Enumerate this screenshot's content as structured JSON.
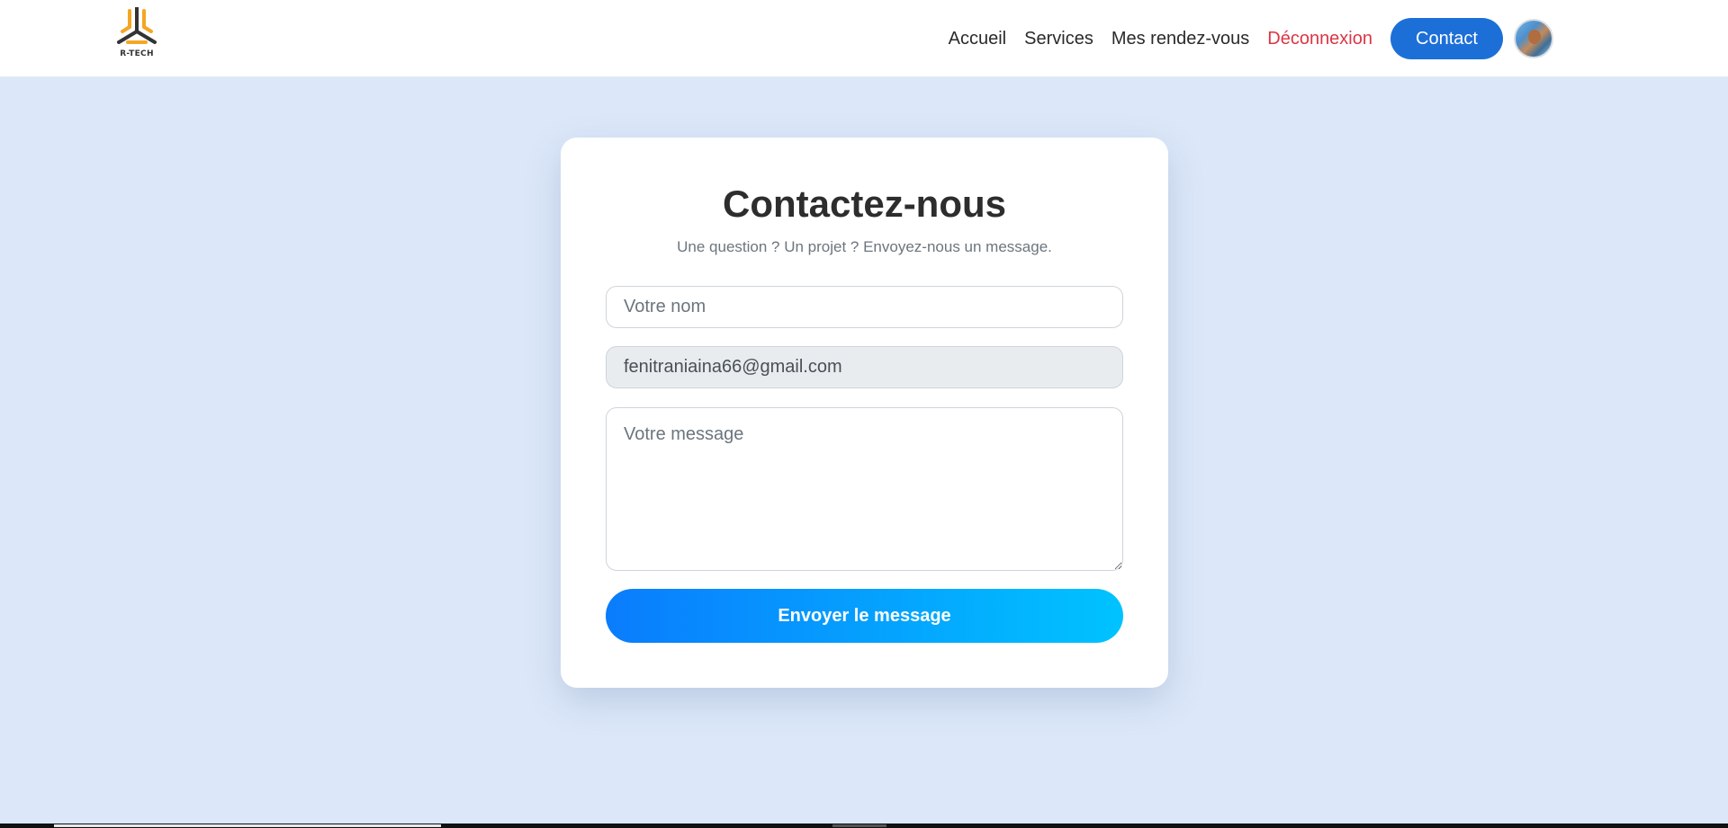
{
  "brand": {
    "logo_text": "R-TECH",
    "logo_icon": "tri-arms-logo-icon"
  },
  "nav": {
    "items": [
      {
        "label": "Accueil"
      },
      {
        "label": "Services"
      },
      {
        "label": "Mes rendez-vous"
      },
      {
        "label": "Déconnexion",
        "color": "#dc3545"
      }
    ],
    "contact_button": "Contact",
    "avatar_icon": "user-avatar-icon"
  },
  "form": {
    "title": "Contactez-nous",
    "subtitle": "Une question ? Un projet ? Envoyez-nous un message.",
    "name_placeholder": "Votre nom",
    "email_value": "fenitraniaina66@gmail.com",
    "message_placeholder": "Votre message",
    "submit_label": "Envoyer le message"
  },
  "colors": {
    "background": "#dce8f9",
    "accent": "#1d6fd8",
    "danger": "#dc3545",
    "gradient_start": "#0a7cfd",
    "gradient_end": "#00c3ff"
  }
}
